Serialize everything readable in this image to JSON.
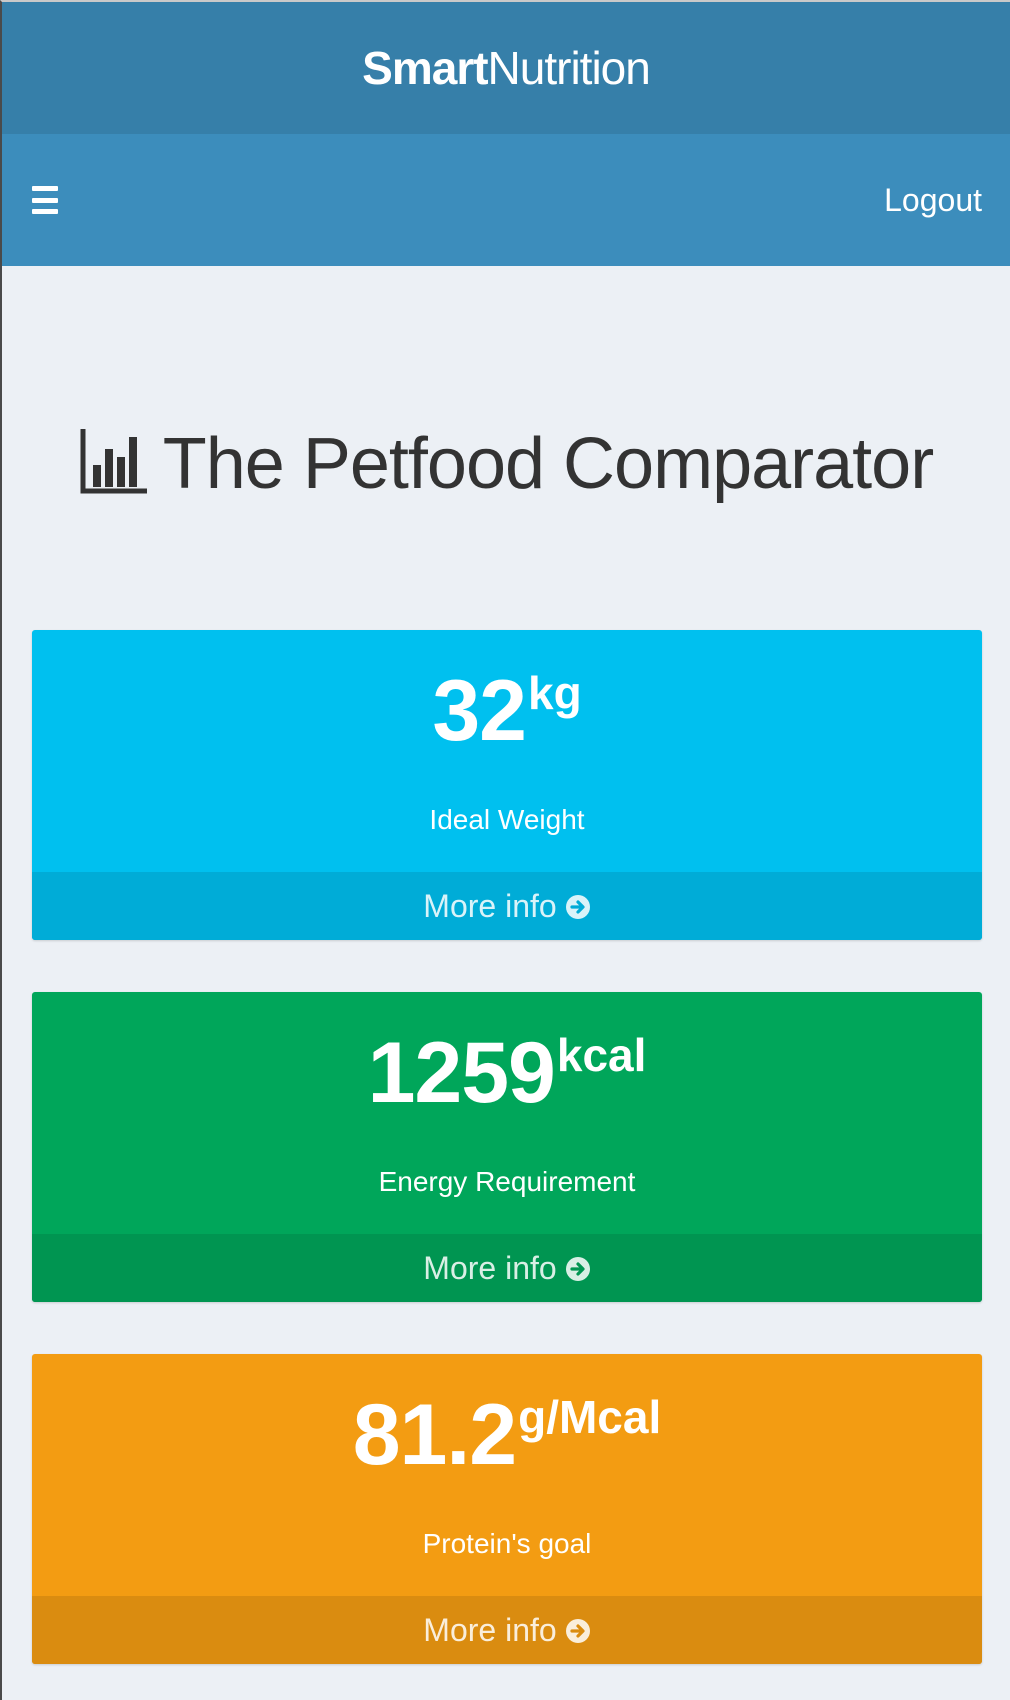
{
  "brand": {
    "strong": "Smart",
    "light": "Nutrition"
  },
  "navbar": {
    "logout_label": "Logout",
    "menu_icon": "hamburger-menu-icon"
  },
  "page": {
    "title": "The Petfood Comparator",
    "title_icon": "bar-chart-icon"
  },
  "boxes": [
    {
      "value": "32",
      "unit": "kg",
      "label": "Ideal Weight",
      "footer": "More info",
      "color": "#00c0ef"
    },
    {
      "value": "1259",
      "unit": "kcal",
      "label": "Energy Requirement",
      "footer": "More info",
      "color": "#00a65a"
    },
    {
      "value": "81.2",
      "unit": "g/Mcal",
      "label": "Protein's goal",
      "footer": "More info",
      "color": "#f39c12"
    }
  ],
  "colors": {
    "brand_header": "#367fa9",
    "navbar": "#3c8dbc",
    "background": "#ecf0f5"
  }
}
